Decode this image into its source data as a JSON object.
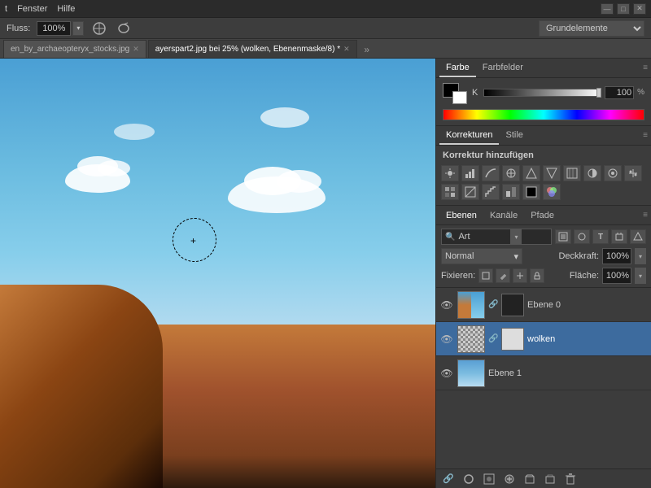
{
  "titleBar": {
    "menu": [
      "t",
      "Fenster",
      "Hilfe"
    ],
    "windowControls": [
      "—",
      "□",
      "✕"
    ]
  },
  "optionsBar": {
    "flussLabel": "Fluss:",
    "flussValue": "100%",
    "presetValue": "Grundelemente"
  },
  "tabs": [
    {
      "label": "en_by_archaeopteryx_stocks.jpg",
      "active": false
    },
    {
      "label": "ayerspart2.jpg bei 25% (wolken, Ebenenmaske/8) *",
      "active": true
    }
  ],
  "colorPanel": {
    "tabs": [
      "Farbe",
      "Farbfelder"
    ],
    "activeTab": "Farbe",
    "channelLabel": "K",
    "channelValue": "100",
    "channelUnit": "%"
  },
  "korrekturen": {
    "title": "Korrekturen",
    "tabKorrekturen": "Korrekturen",
    "tabStile": "Stile",
    "addLabel": "Korrektur hinzufügen",
    "icons": [
      "☀",
      "▦",
      "◑",
      "⬡",
      "△",
      "▽",
      "⊞",
      "⊡",
      "◐",
      "⚙",
      "⬛",
      "⊟",
      "═",
      "▤",
      "▥",
      "▦",
      "◧",
      "▨"
    ]
  },
  "ebenen": {
    "tabs": [
      "Ebenen",
      "Kanäle",
      "Pfade"
    ],
    "activeTab": "Ebenen",
    "searchPlaceholder": "Art",
    "blendMode": "Normal",
    "deckkraftLabel": "Deckkraft:",
    "deckkraftValue": "100%",
    "fixierenLabel": "Fixieren:",
    "flacheLabel": "Fläche:",
    "flacheValue": "100%",
    "layers": [
      {
        "name": "Ebene 0",
        "visible": true,
        "selected": false,
        "hasMask": true,
        "maskBlack": true
      },
      {
        "name": "wolken",
        "visible": true,
        "selected": true,
        "hasMask": true,
        "maskWhite": true
      },
      {
        "name": "Ebene 1",
        "visible": true,
        "selected": false,
        "hasMask": false,
        "isSky": true
      }
    ]
  }
}
